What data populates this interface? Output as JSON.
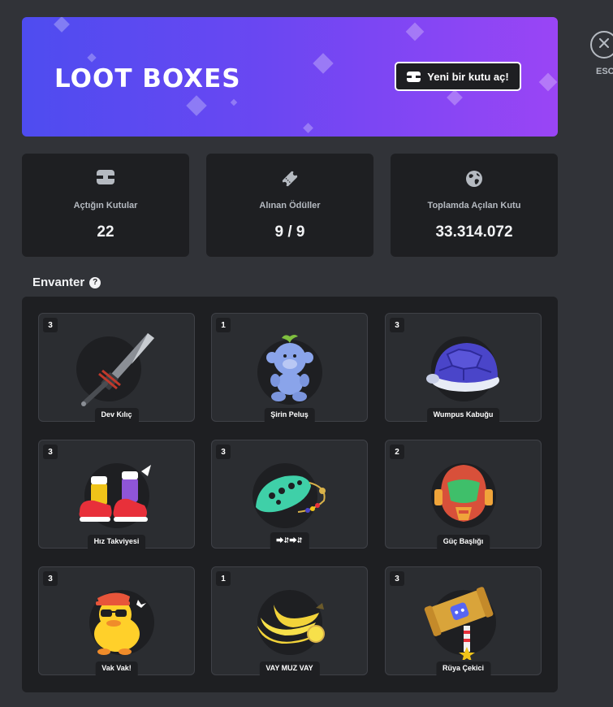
{
  "banner": {
    "logo_text": "LOOT BOXES",
    "open_button_label": "Yeni bir kutu aç!"
  },
  "close": {
    "label": "ESC"
  },
  "stats": [
    {
      "label": "Açtığın Kutular",
      "value": "22",
      "icon": "box-icon"
    },
    {
      "label": "Alınan Ödüller",
      "value": "9 / 9",
      "icon": "ticket-icon"
    },
    {
      "label": "Toplamda Açılan Kutu",
      "value": "33.314.072",
      "icon": "globe-icon"
    }
  ],
  "inventory": {
    "title": "Envanter",
    "help": "?",
    "items": [
      {
        "name": "Dev Kılıç",
        "count": "3",
        "icon": "sword-icon"
      },
      {
        "name": "Şirin Peluş",
        "count": "1",
        "icon": "plush-icon"
      },
      {
        "name": "Wumpus Kabuğu",
        "count": "3",
        "icon": "shell-icon"
      },
      {
        "name": "Hız Takviyesi",
        "count": "3",
        "icon": "shoes-icon"
      },
      {
        "name": "⮕⮃⮕⮃",
        "count": "3",
        "icon": "ocarina-icon"
      },
      {
        "name": "Güç Başlığı",
        "count": "2",
        "icon": "helmet-icon"
      },
      {
        "name": "Vak Vak!",
        "count": "3",
        "icon": "duck-icon"
      },
      {
        "name": "VAY MUZ VAY",
        "count": "1",
        "icon": "banana-icon"
      },
      {
        "name": "Rüya Çekici",
        "count": "3",
        "icon": "hammer-icon"
      }
    ]
  },
  "colors": {
    "background": "#313338",
    "panel": "#1e1f22",
    "card": "#2b2d31",
    "banner_start": "#4e4cf0",
    "banner_end": "#9a45f5"
  }
}
